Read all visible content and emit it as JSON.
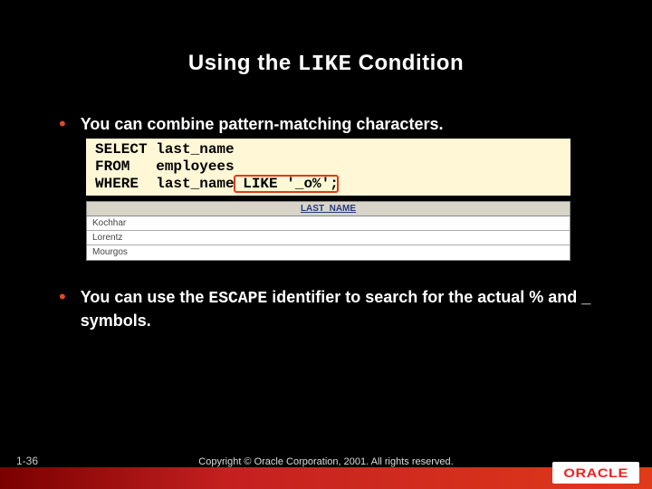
{
  "title": {
    "pre": "Using the ",
    "code": "LIKE",
    "post": " Condition"
  },
  "bullets": {
    "b1": "You can combine pattern-matching characters.",
    "b2_pre": "You can use the ",
    "b2_code": "ESCAPE",
    "b2_post": " identifier to search for the actual % and _ symbols."
  },
  "sql": {
    "line1": "SELECT last_name",
    "line2": "FROM   employees",
    "line3": "WHERE  last_name LIKE '_o%';"
  },
  "result": {
    "header": "LAST_NAME",
    "rows": [
      "Kochhar",
      "Lorentz",
      "Mourgos"
    ]
  },
  "footer": {
    "slide_num": "1-36",
    "copyright": "Copyright © Oracle Corporation, 2001. All rights reserved.",
    "logo": "ORACLE"
  }
}
